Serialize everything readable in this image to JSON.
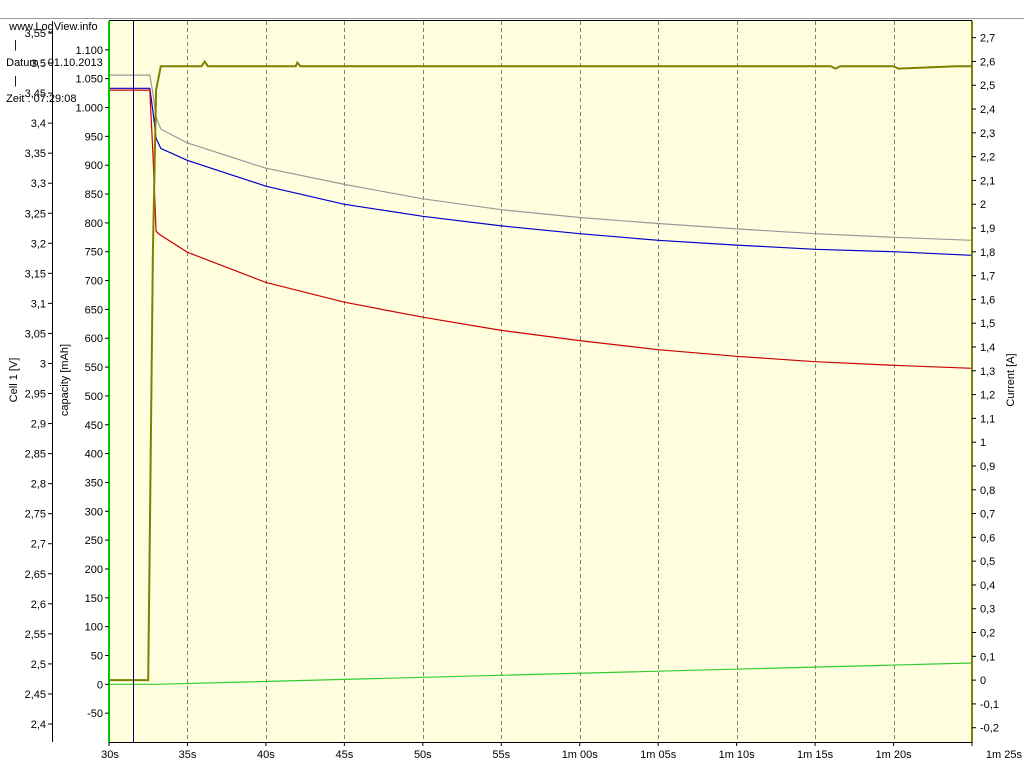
{
  "header": {
    "site": "www.LogView.info",
    "sep": "|",
    "date_label": "Datum : 01.10.2013",
    "time_label": "Zeit : 07:29:08"
  },
  "chart_data": {
    "type": "line",
    "x_unit": "seconds",
    "xlim": [
      30,
      85
    ],
    "x_ticks": [
      {
        "value": 30,
        "label": "30s"
      },
      {
        "value": 35,
        "label": "35s"
      },
      {
        "value": 40,
        "label": "40s"
      },
      {
        "value": 45,
        "label": "45s"
      },
      {
        "value": 50,
        "label": "50s"
      },
      {
        "value": 55,
        "label": "55s"
      },
      {
        "value": 60,
        "label": "1m 00s"
      },
      {
        "value": 65,
        "label": "1m 05s"
      },
      {
        "value": 70,
        "label": "1m 10s"
      },
      {
        "value": 75,
        "label": "1m 15s"
      },
      {
        "value": 80,
        "label": "1m 20s"
      },
      {
        "value": 85,
        "label": "1m 25s"
      }
    ],
    "axes": {
      "cell": {
        "label": "Cell 1 [V]",
        "ylim": [
          2.37,
          3.57
        ],
        "ticks": [
          "3,55",
          "3,5",
          "3,45",
          "3,4",
          "3,35",
          "3,3",
          "3,25",
          "3,2",
          "3,15",
          "3,1",
          "3,05",
          "3",
          "2,95",
          "2,9",
          "2,85",
          "2,8",
          "2,75",
          "2,7",
          "2,65",
          "2,6",
          "2,55",
          "2,5",
          "2,45",
          "2,4"
        ],
        "tick_values": [
          3.55,
          3.5,
          3.45,
          3.4,
          3.35,
          3.3,
          3.25,
          3.2,
          3.15,
          3.1,
          3.05,
          3.0,
          2.95,
          2.9,
          2.85,
          2.8,
          2.75,
          2.7,
          2.65,
          2.6,
          2.55,
          2.5,
          2.45,
          2.4
        ]
      },
      "capacity": {
        "label": "capacity [mAh]",
        "ylim": [
          -100,
          1150
        ],
        "ticks": [
          "1.100",
          "1.050",
          "1.000",
          "950",
          "900",
          "850",
          "800",
          "750",
          "700",
          "650",
          "600",
          "550",
          "500",
          "450",
          "400",
          "350",
          "300",
          "250",
          "200",
          "150",
          "100",
          "50",
          "0",
          "-50"
        ],
        "tick_values": [
          1100,
          1050,
          1000,
          950,
          900,
          850,
          800,
          750,
          700,
          650,
          600,
          550,
          500,
          450,
          400,
          350,
          300,
          250,
          200,
          150,
          100,
          50,
          0,
          -50
        ]
      },
      "current": {
        "label": "Current [A]",
        "ylim": [
          -0.26,
          2.77
        ],
        "ticks": [
          "2,7",
          "2,6",
          "2,5",
          "2,4",
          "2,3",
          "2,2",
          "2,1",
          "2",
          "1,9",
          "1,8",
          "1,7",
          "1,6",
          "1,5",
          "1,4",
          "1,3",
          "1,2",
          "1,1",
          "1",
          "0,9",
          "0,8",
          "0,7",
          "0,6",
          "0,5",
          "0,4",
          "0,3",
          "0,2",
          "0,1",
          "0",
          "-0,1",
          "-0,2"
        ],
        "tick_values": [
          2.7,
          2.6,
          2.5,
          2.4,
          2.3,
          2.2,
          2.1,
          2.0,
          1.9,
          1.8,
          1.7,
          1.6,
          1.5,
          1.4,
          1.3,
          1.2,
          1.1,
          1.0,
          0.9,
          0.8,
          0.7,
          0.6,
          0.5,
          0.4,
          0.3,
          0.2,
          0.1,
          0.0,
          -0.1,
          -0.2
        ]
      }
    },
    "grid": true,
    "cursor_x": 31.5,
    "series": [
      {
        "axis": "cell",
        "color": "#999999",
        "x": [
          30,
          32.6,
          32.8,
          33.0,
          33.3,
          35,
          40,
          45,
          50,
          55,
          60,
          65,
          70,
          75,
          80,
          85
        ],
        "y": [
          3.48,
          3.48,
          3.45,
          3.41,
          3.39,
          3.367,
          3.325,
          3.298,
          3.274,
          3.256,
          3.243,
          3.233,
          3.224,
          3.216,
          3.21,
          3.205
        ]
      },
      {
        "axis": "cell",
        "color": "#0000cc",
        "x": [
          30,
          32.6,
          32.8,
          33.0,
          33.3,
          35,
          40,
          45,
          50,
          55,
          60,
          65,
          70,
          75,
          80,
          85
        ],
        "y": [
          3.458,
          3.458,
          3.42,
          3.375,
          3.358,
          3.338,
          3.295,
          3.265,
          3.245,
          3.229,
          3.216,
          3.205,
          3.197,
          3.19,
          3.186,
          3.18
        ]
      },
      {
        "axis": "cell",
        "color": "#cc0000",
        "x": [
          30,
          32.6,
          32.8,
          33.0,
          33.2,
          35,
          40,
          45,
          50,
          55,
          60,
          65,
          70,
          75,
          80,
          85
        ],
        "y": [
          3.455,
          3.455,
          3.35,
          3.22,
          3.215,
          3.185,
          3.135,
          3.102,
          3.077,
          3.055,
          3.038,
          3.023,
          3.012,
          3.003,
          2.997,
          2.992
        ]
      },
      {
        "axis": "capacity",
        "color": "#33cc33",
        "x": [
          30,
          33,
          85
        ],
        "y": [
          0,
          0,
          37
        ]
      },
      {
        "axis": "current",
        "color": "#808000",
        "x": [
          30,
          32.5,
          32.6,
          32.8,
          33.0,
          33.3,
          35.9,
          36.1,
          36.3,
          41.9,
          42.0,
          42.2,
          70,
          76,
          76.3,
          76.6,
          80,
          80.3,
          84,
          85
        ],
        "y": [
          0,
          0,
          0.6,
          1.8,
          2.48,
          2.58,
          2.58,
          2.6,
          2.58,
          2.58,
          2.595,
          2.58,
          2.58,
          2.58,
          2.57,
          2.58,
          2.58,
          2.57,
          2.58,
          2.58
        ]
      }
    ]
  }
}
